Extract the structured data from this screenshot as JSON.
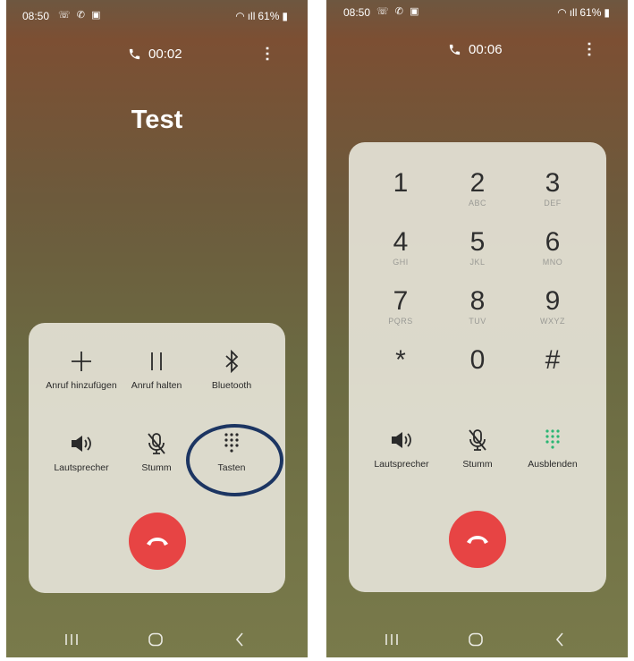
{
  "left_screen": {
    "status": {
      "time": "08:50",
      "icons": "☏ ✆ ▣",
      "wifi": "◠",
      "signal": "ıll",
      "battery": "61%"
    },
    "call": {
      "timer": "00:02",
      "contact_name": "Test"
    },
    "controls": [
      {
        "id": "add-call",
        "label": "Anruf hinzufügen",
        "icon": "plus-icon"
      },
      {
        "id": "hold-call",
        "label": "Anruf halten",
        "icon": "pause-icon"
      },
      {
        "id": "bluetooth",
        "label": "Bluetooth",
        "icon": "bluetooth-icon"
      },
      {
        "id": "speaker",
        "label": "Lautsprecher",
        "icon": "speaker-icon"
      },
      {
        "id": "mute",
        "label": "Stumm",
        "icon": "mic-off-icon"
      },
      {
        "id": "keypad",
        "label": "Tasten",
        "icon": "keypad-icon"
      }
    ],
    "highlight_color": "#1c3562"
  },
  "right_screen": {
    "status": {
      "time": "08:50",
      "icons": "☏ ✆ ▣",
      "wifi": "◠",
      "signal": "ıll",
      "battery": "61%"
    },
    "call": {
      "timer": "00:06"
    },
    "keypad": [
      {
        "digit": "1",
        "letters": ""
      },
      {
        "digit": "2",
        "letters": "ABC"
      },
      {
        "digit": "3",
        "letters": "DEF"
      },
      {
        "digit": "4",
        "letters": "GHI"
      },
      {
        "digit": "5",
        "letters": "JKL"
      },
      {
        "digit": "6",
        "letters": "MNO"
      },
      {
        "digit": "7",
        "letters": "PQRS"
      },
      {
        "digit": "8",
        "letters": "TUV"
      },
      {
        "digit": "9",
        "letters": "WXYZ"
      },
      {
        "digit": "*",
        "letters": ""
      },
      {
        "digit": "0",
        "letters": ""
      },
      {
        "digit": "#",
        "letters": ""
      }
    ],
    "controls": [
      {
        "id": "speaker",
        "label": "Lautsprecher",
        "icon": "speaker-icon"
      },
      {
        "id": "mute",
        "label": "Stumm",
        "icon": "mic-off-icon"
      },
      {
        "id": "hide-keypad",
        "label": "Ausblenden",
        "icon": "keypad-icon"
      }
    ],
    "active_color": "#2bb673"
  },
  "colors": {
    "end_call": "#e74444",
    "panel": "#e4e2d6"
  }
}
